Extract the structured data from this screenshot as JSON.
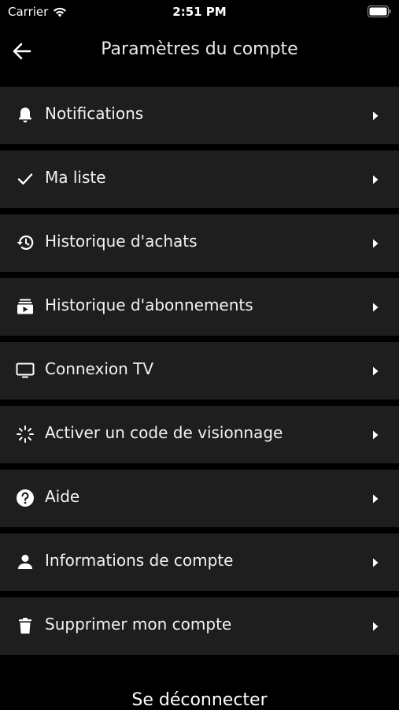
{
  "status_bar": {
    "carrier": "Carrier",
    "time": "2:51 PM"
  },
  "header": {
    "title": "Paramètres du compte",
    "back_icon": "arrow-left-icon"
  },
  "menu": {
    "items": [
      {
        "label": "Notifications",
        "icon": "bell-icon"
      },
      {
        "label": "Ma liste",
        "icon": "check-icon"
      },
      {
        "label": "Historique d'achats",
        "icon": "history-icon"
      },
      {
        "label": "Historique d'abonnements",
        "icon": "subscriptions-icon"
      },
      {
        "label": "Connexion TV",
        "icon": "tv-icon"
      },
      {
        "label": "Activer un code de visionnage",
        "icon": "sparkle-icon"
      },
      {
        "label": "Aide",
        "icon": "help-circle-icon"
      },
      {
        "label": "Informations de compte",
        "icon": "person-icon"
      },
      {
        "label": "Supprimer mon compte",
        "icon": "trash-icon"
      }
    ]
  },
  "footer": {
    "logout_label": "Se déconnecter"
  },
  "colors": {
    "background": "#000000",
    "row_background": "#1e1e1e",
    "text": "#f2f2f2"
  }
}
